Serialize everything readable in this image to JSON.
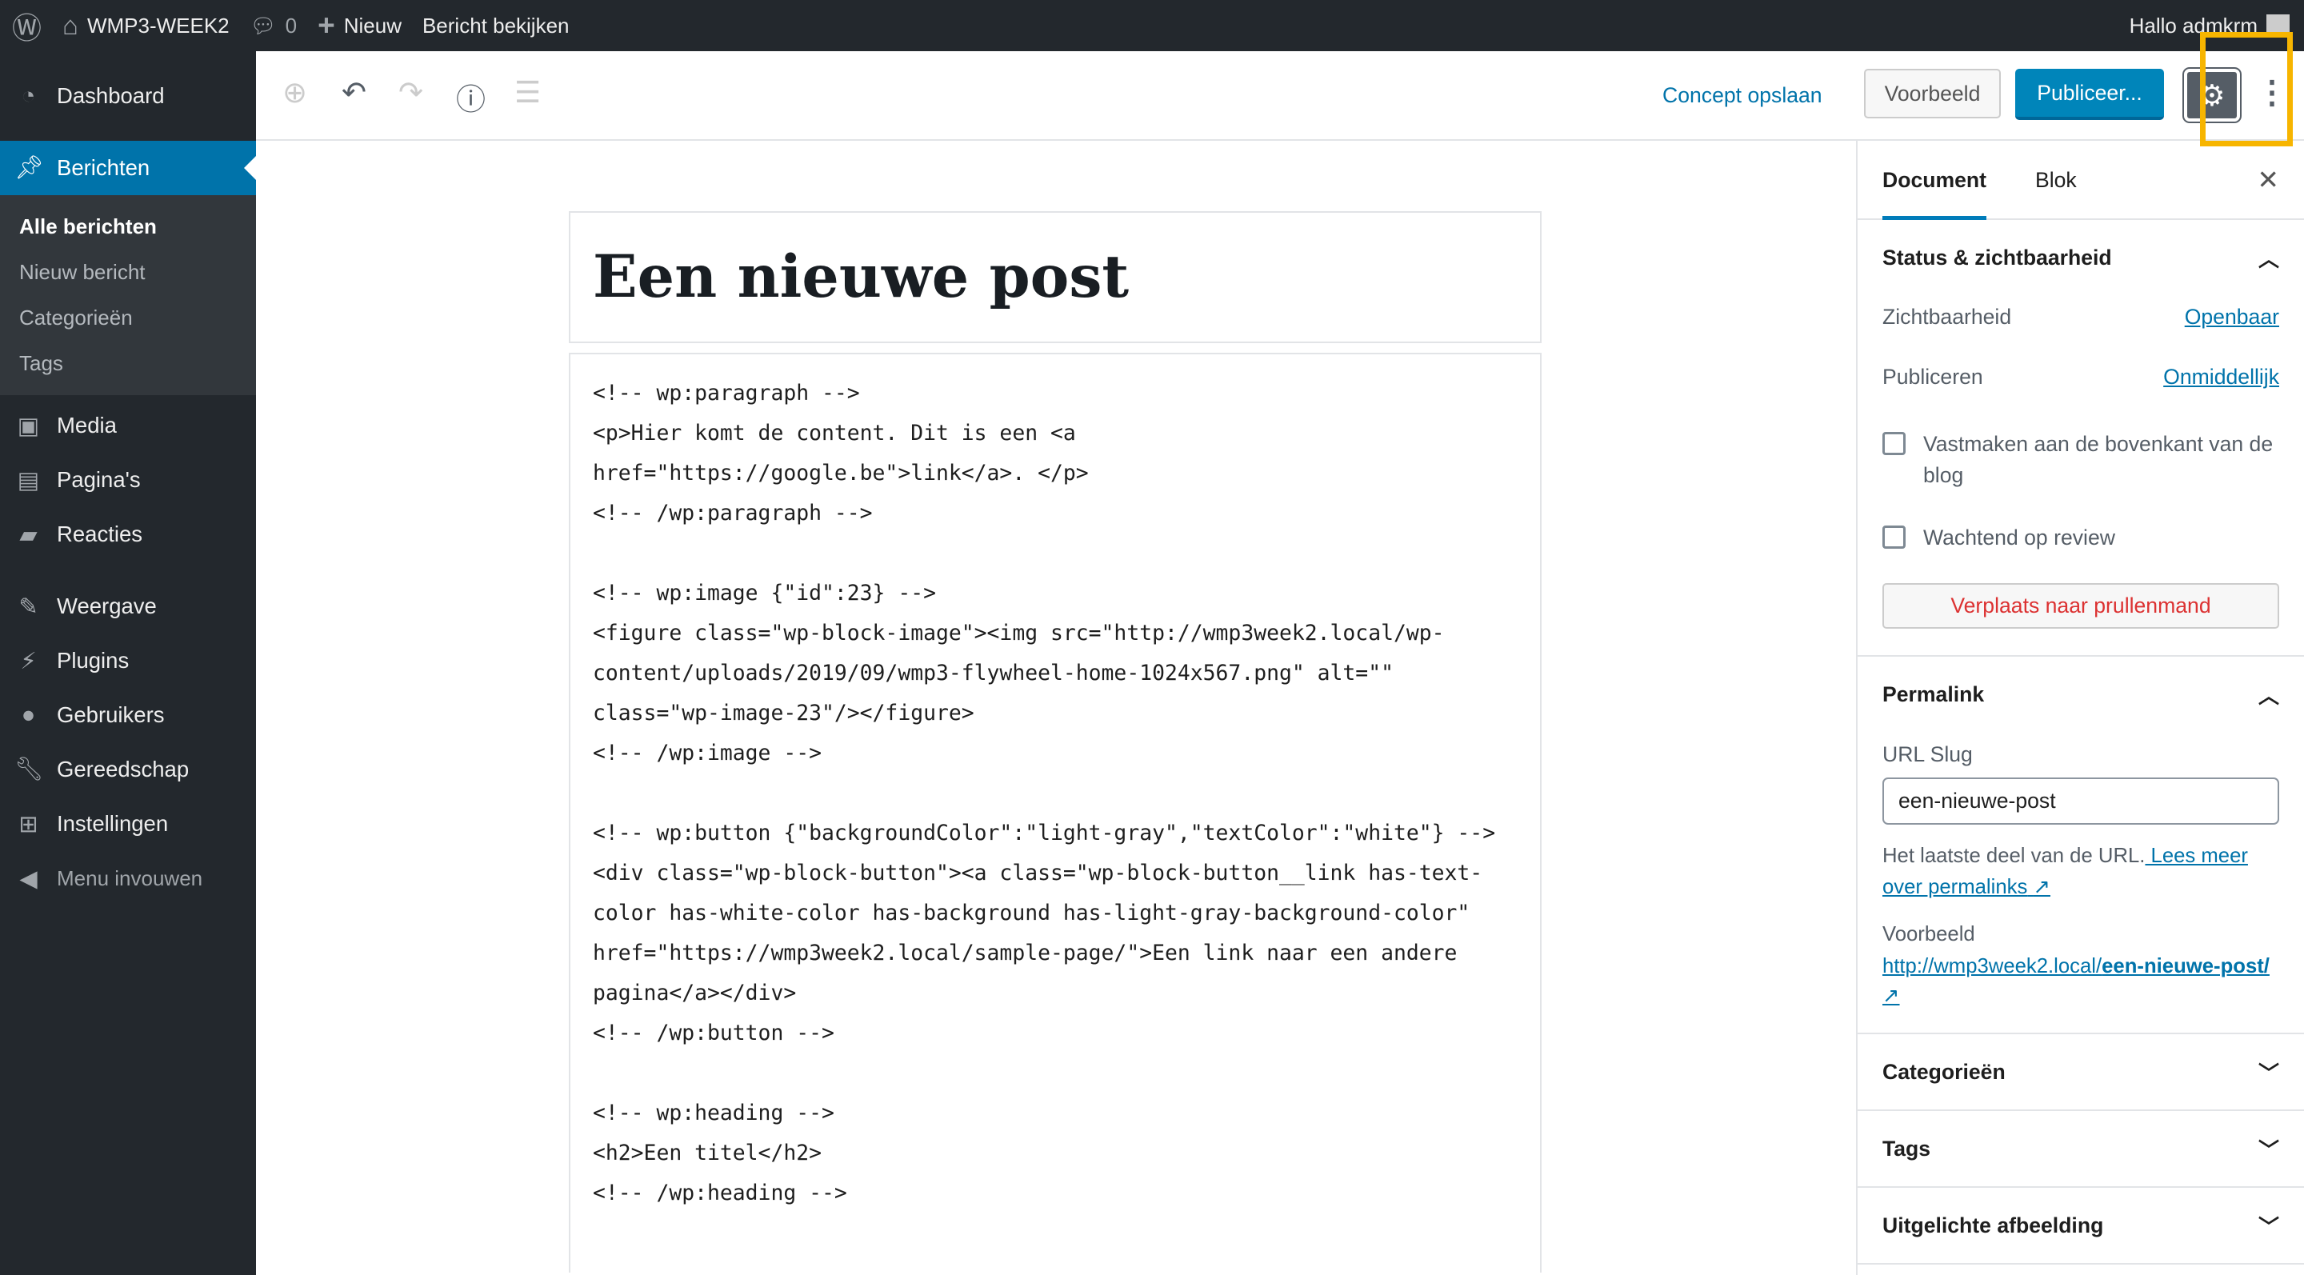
{
  "adminbar": {
    "site": "WMP3-WEEK2",
    "comments": "0",
    "new": "Nieuw",
    "view_post": "Bericht bekijken",
    "greeting": "Hallo admkrm"
  },
  "sidebar": {
    "items": [
      {
        "label": "Dashboard",
        "icon": "dashboard-icon"
      },
      {
        "label": "Berichten",
        "icon": "pin-icon"
      },
      {
        "label": "Media",
        "icon": "media-icon"
      },
      {
        "label": "Pagina's",
        "icon": "pages-icon"
      },
      {
        "label": "Reacties",
        "icon": "comment-icon"
      },
      {
        "label": "Weergave",
        "icon": "brush-icon"
      },
      {
        "label": "Plugins",
        "icon": "plugin-icon"
      },
      {
        "label": "Gebruikers",
        "icon": "user-icon"
      },
      {
        "label": "Gereedschap",
        "icon": "wrench-icon"
      },
      {
        "label": "Instellingen",
        "icon": "settings-icon"
      },
      {
        "label": "Menu invouwen",
        "icon": "collapse-icon"
      }
    ],
    "submenu": [
      "Alle berichten",
      "Nieuw bericht",
      "Categorieën",
      "Tags"
    ]
  },
  "toolbar": {
    "save_draft": "Concept opslaan",
    "preview": "Voorbeeld",
    "publish": "Publiceer..."
  },
  "editor": {
    "title": "Een nieuwe post",
    "code": "<!-- wp:paragraph -->\n<p>Hier komt de content. Dit is een <a href=\"https://google.be\">link</a>. </p>\n<!-- /wp:paragraph -->\n\n<!-- wp:image {\"id\":23} -->\n<figure class=\"wp-block-image\"><img src=\"http://wmp3week2.local/wp-content/uploads/2019/09/wmp3-flywheel-home-1024x567.png\" alt=\"\" class=\"wp-image-23\"/></figure>\n<!-- /wp:image -->\n\n<!-- wp:button {\"backgroundColor\":\"light-gray\",\"textColor\":\"white\"} -->\n<div class=\"wp-block-button\"><a class=\"wp-block-button__link has-text-color has-white-color has-background has-light-gray-background-color\" href=\"https://wmp3week2.local/sample-page/\">Een link naar een andere pagina</a></div>\n<!-- /wp:button -->\n\n<!-- wp:heading -->\n<h2>Een titel</h2>\n<!-- /wp:heading -->"
  },
  "panel": {
    "tabs": [
      "Document",
      "Blok"
    ],
    "status": {
      "title": "Status & zichtbaarheid",
      "visibility_label": "Zichtbaarheid",
      "visibility_value": "Openbaar",
      "publish_label": "Publiceren",
      "publish_value": "Onmiddellijk",
      "sticky": "Vastmaken aan de bovenkant van de blog",
      "pending": "Wachtend op review",
      "trash": "Verplaats naar prullenmand"
    },
    "permalink": {
      "title": "Permalink",
      "slug_label": "URL Slug",
      "slug": "een-nieuwe-post",
      "help": "Het laatste deel van de URL.",
      "help_link": " Lees meer over permalinks",
      "preview_label": "Voorbeeld",
      "url_base": "http://wmp3week2.local/",
      "url_slug": "een-nieuwe-post/"
    },
    "sections": [
      "Categorieën",
      "Tags",
      "Uitgelichte afbeelding"
    ]
  },
  "colors": {
    "accent": "#0085ba",
    "highlight": "#f7b500",
    "adminbar": "#23282d"
  }
}
